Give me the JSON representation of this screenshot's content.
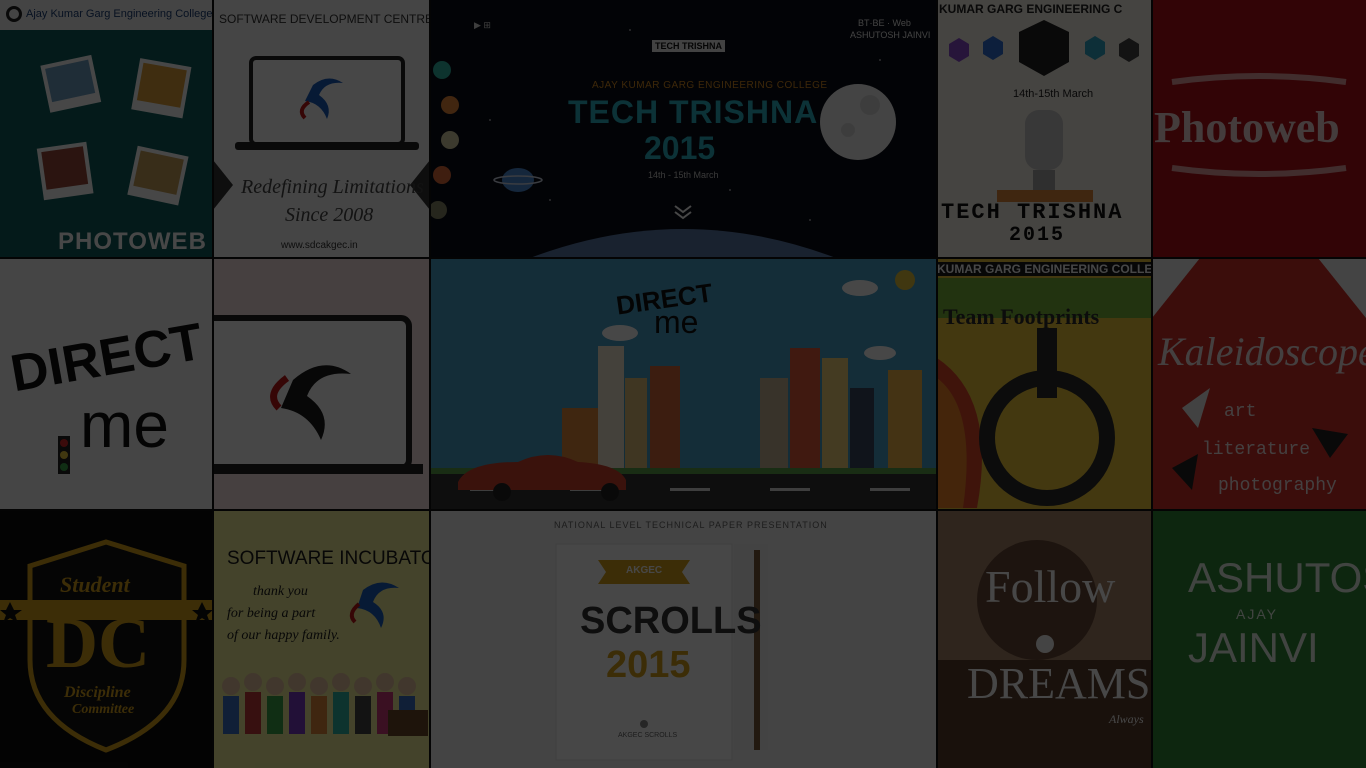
{
  "tiles": {
    "t1": {
      "header": "Ajay Kumar Garg Engineering College",
      "caption": "PHOTOWEB"
    },
    "t2": {
      "header": "SOFTWARE DEVELOPMENT CENTRE",
      "tagline": "Redefining Limitations",
      "since": "Since 2008",
      "url": "www.sdcakgec.in"
    },
    "t3": {
      "college": "AJAY KUMAR GARG ENGINEERING COLLEGE",
      "title": "TECH TRISHNA",
      "year": "2015",
      "dates": "14th - 15th March",
      "header_right1": "BT·BE · Web",
      "header_right2": "ASHUTOSH JAINVI",
      "badge": "TECH TRISHNA"
    },
    "t4": {
      "header": "KUMAR GARG ENGINEERING C",
      "dates": "14th-15th March",
      "poster_line1": "TECH TRISHNA",
      "poster_line2": "2015"
    },
    "t5": {
      "title": "Photoweb"
    },
    "t6": {
      "word1": "DIRECT",
      "word2": "me"
    },
    "t7": {},
    "t8": {
      "word1": "DIRECT",
      "word2": "me"
    },
    "t9": {
      "header": "KUMAR GARG ENGINEERING COLLE",
      "title": "Team Footprints"
    },
    "t10": {
      "title": "Kaleidoscope",
      "items": [
        "art",
        "literature",
        "photography"
      ]
    },
    "t11": {
      "line1": "Student",
      "initials": "DC",
      "line2": "Discipline",
      "line3": "Committee"
    },
    "t12": {
      "title": "SOFTWARE INCUBATOR",
      "msg1": "thank you",
      "msg2": "for being a part",
      "msg3": "of our happy family."
    },
    "t13": {
      "header": "NATIONAL LEVEL TECHNICAL PAPER PRESENTATION",
      "ribbon": "AKGEC",
      "title": "SCROLLS",
      "year": "2015",
      "footer": "AKGEC SCROLLS"
    },
    "t14": {
      "word1": "Follow",
      "word2": "DREAMS",
      "sign": "Always"
    },
    "t15": {
      "line1": "ASHUTOSH",
      "line2": "AJAY",
      "line3": "JAINVI"
    }
  },
  "colors": {
    "teal": "#0f5f5d",
    "red": "#b30f16",
    "green": "#2f8a36",
    "sky": "#4aa0c8",
    "gold": "#d8a21c",
    "kaleido": "#d4312a"
  }
}
